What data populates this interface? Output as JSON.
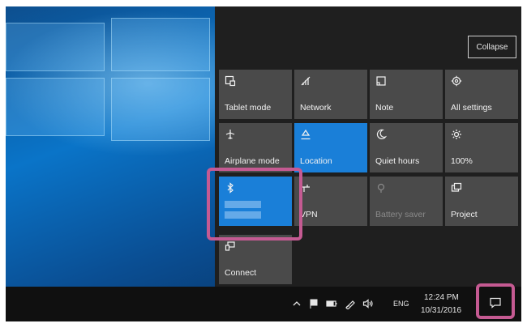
{
  "action_center": {
    "collapse_label": "Collapse",
    "tiles": [
      {
        "label": "Tablet mode",
        "icon": "tablet-mode-icon",
        "active": false
      },
      {
        "label": "Network",
        "icon": "network-icon",
        "active": false
      },
      {
        "label": "Note",
        "icon": "note-icon",
        "active": false
      },
      {
        "label": "All settings",
        "icon": "gear-icon",
        "active": false
      },
      {
        "label": "Airplane mode",
        "icon": "airplane-icon",
        "active": false
      },
      {
        "label": "Location",
        "icon": "location-icon",
        "active": true
      },
      {
        "label": "Quiet hours",
        "icon": "moon-icon",
        "active": false
      },
      {
        "label": "100%",
        "icon": "brightness-icon",
        "active": false
      },
      {
        "label": "",
        "icon": "bluetooth-icon",
        "active": true
      },
      {
        "label": "VPN",
        "icon": "vpn-icon",
        "active": false
      },
      {
        "label": "Battery saver",
        "icon": "battery-saver-icon",
        "active": false,
        "disabled": true
      },
      {
        "label": "Project",
        "icon": "project-icon",
        "active": false
      },
      {
        "label": "Connect",
        "icon": "connect-icon",
        "active": false
      }
    ]
  },
  "taskbar": {
    "language": "ENG",
    "time": "12:24 PM",
    "date": "10/31/2016",
    "tray_icons": [
      "chevron-up-icon",
      "flag-icon",
      "battery-icon",
      "pen-icon",
      "volume-icon"
    ]
  },
  "colors": {
    "accent": "#1a7fd8",
    "tile": "#4a4a4a",
    "panel": "#1f1f1f",
    "highlight": "#c55a92"
  }
}
